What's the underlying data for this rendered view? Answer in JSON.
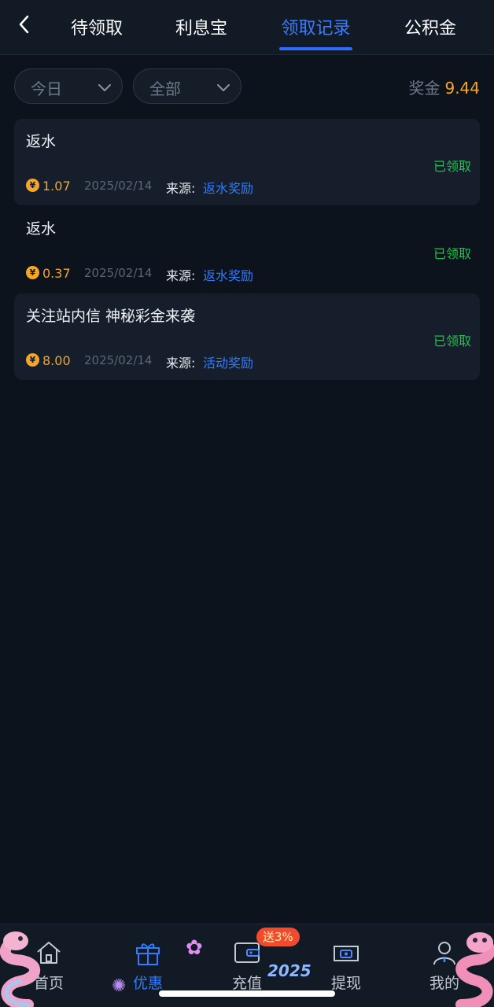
{
  "header": {
    "tabs": [
      {
        "label": "待领取"
      },
      {
        "label": "利息宝"
      },
      {
        "label": "领取记录"
      },
      {
        "label": "公积金"
      }
    ]
  },
  "filters": {
    "date": "今日",
    "type": "全部"
  },
  "bonus": {
    "label": "奖金",
    "value": "9.44"
  },
  "records": [
    {
      "title": "返水",
      "status": "已领取",
      "coin": "¥",
      "amount": "1.07",
      "date": "2025/02/14",
      "source_label": "来源:",
      "source": "返水奖励"
    },
    {
      "title": "返水",
      "status": "已领取",
      "coin": "¥",
      "amount": "0.37",
      "date": "2025/02/14",
      "source_label": "来源:",
      "source": "返水奖励"
    },
    {
      "title": "关注站内信 神秘彩金来袭",
      "status": "已领取",
      "coin": "¥",
      "amount": "8.00",
      "date": "2025/02/14",
      "source_label": "来源:",
      "source": "活动奖励"
    }
  ],
  "nav": {
    "items": [
      {
        "label": "首页",
        "icon": "home-icon"
      },
      {
        "label": "优惠",
        "icon": "gift-icon"
      },
      {
        "label": "充值",
        "icon": "wallet-icon"
      },
      {
        "label": "提现",
        "icon": "withdraw-icon"
      },
      {
        "label": "我的",
        "icon": "profile-icon"
      }
    ],
    "promo_badge": "送3%",
    "year_decoration": "2025"
  },
  "colors": {
    "accent": "#2f7bff",
    "gold": "#f5a623",
    "success": "#19c54a",
    "background": "#0d131c"
  }
}
